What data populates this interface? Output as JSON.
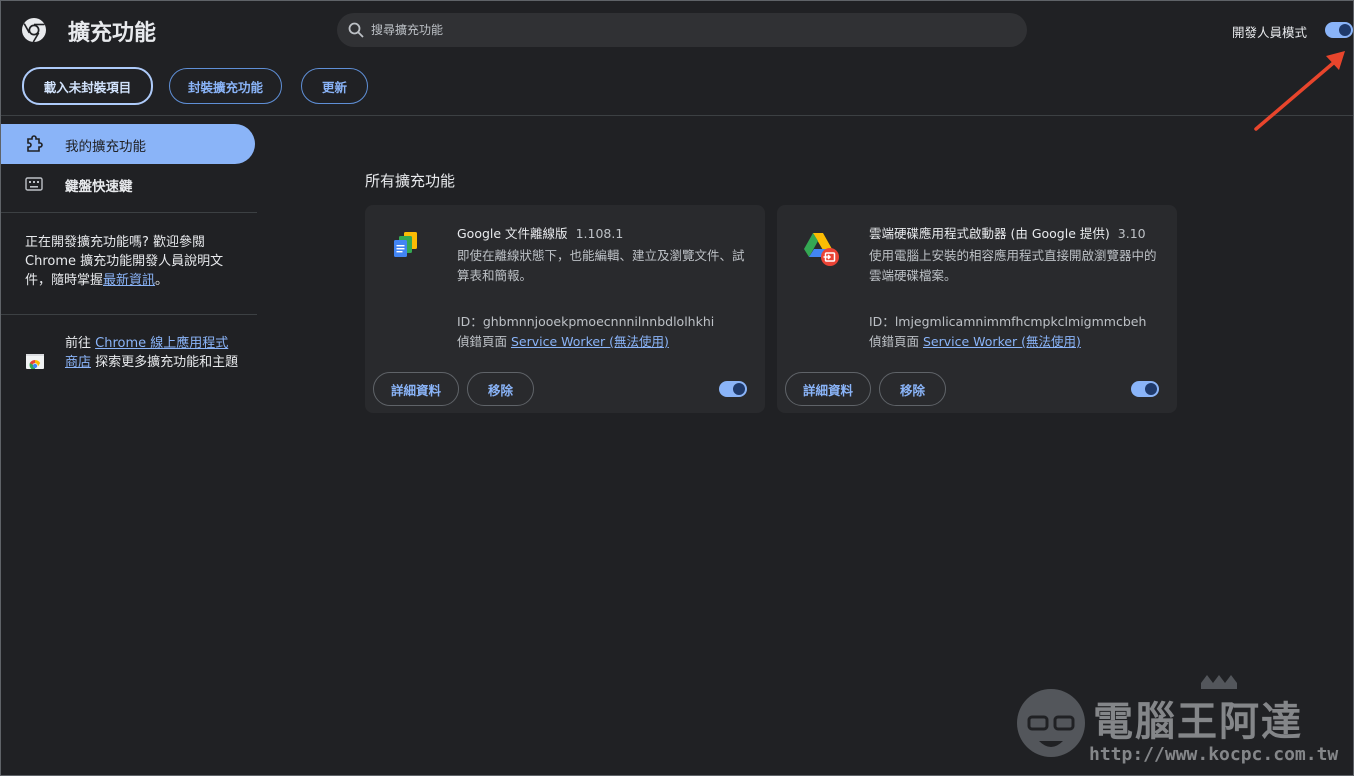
{
  "header": {
    "title": "擴充功能",
    "search_placeholder": "搜尋擴充功能",
    "developer_mode_label": "開發人員模式",
    "developer_mode_on": true,
    "buttons": {
      "load_unpacked": "載入未封裝項目",
      "pack": "封裝擴充功能",
      "update": "更新"
    }
  },
  "sidebar": {
    "items": [
      {
        "label": "我的擴充功能",
        "icon": "puzzle-icon",
        "active": true
      },
      {
        "label": "鍵盤快速鍵",
        "icon": "keyboard-icon",
        "active": false
      }
    ],
    "dev_info": {
      "text": "正在開發擴充功能嗎? 歡迎參閱 Chrome 擴充功能開發人員說明文件，隨時掌握",
      "link": "最新資訊",
      "suffix": "。"
    },
    "store": {
      "prefix": "前往 ",
      "link": "Chrome 線上應用程式商店",
      "suffix": " 探索更多擴充功能和主題"
    }
  },
  "main": {
    "section_title": "所有擴充功能",
    "extensions": [
      {
        "name": "Google 文件離線版",
        "version": "1.108.1",
        "description": "即使在離線狀態下，也能編輯、建立及瀏覽文件、試算表和簡報。",
        "id_label": "ID：",
        "id": "ghbmnnjooekpmoecnnnilnnbdlolhkhi",
        "inspect_label": "偵錯頁面 ",
        "inspect_link": "Service Worker (無法使用)",
        "details_button": "詳細資料",
        "remove_button": "移除",
        "enabled": true,
        "icon": "google-docs-offline-icon"
      },
      {
        "name": "雲端硬碟應用程式啟動器 (由 Google 提供)",
        "version": "3.10",
        "description": "使用電腦上安裝的相容應用程式直接開啟瀏覽器中的雲端硬碟檔案。",
        "id_label": "ID：",
        "id": "lmjegmlicamnimmfhcmpkclmigmmcbeh",
        "inspect_label": "偵錯頁面 ",
        "inspect_link": "Service Worker (無法使用)",
        "details_button": "詳細資料",
        "remove_button": "移除",
        "enabled": true,
        "icon": "google-drive-launcher-icon"
      }
    ]
  },
  "watermark": {
    "text": "電腦王阿達",
    "url": "http://www.kocpc.com.tw"
  },
  "colors": {
    "background": "#202124",
    "accent": "#8ab4f8",
    "card": "#292a2d",
    "annotation_arrow": "#e8452c"
  }
}
